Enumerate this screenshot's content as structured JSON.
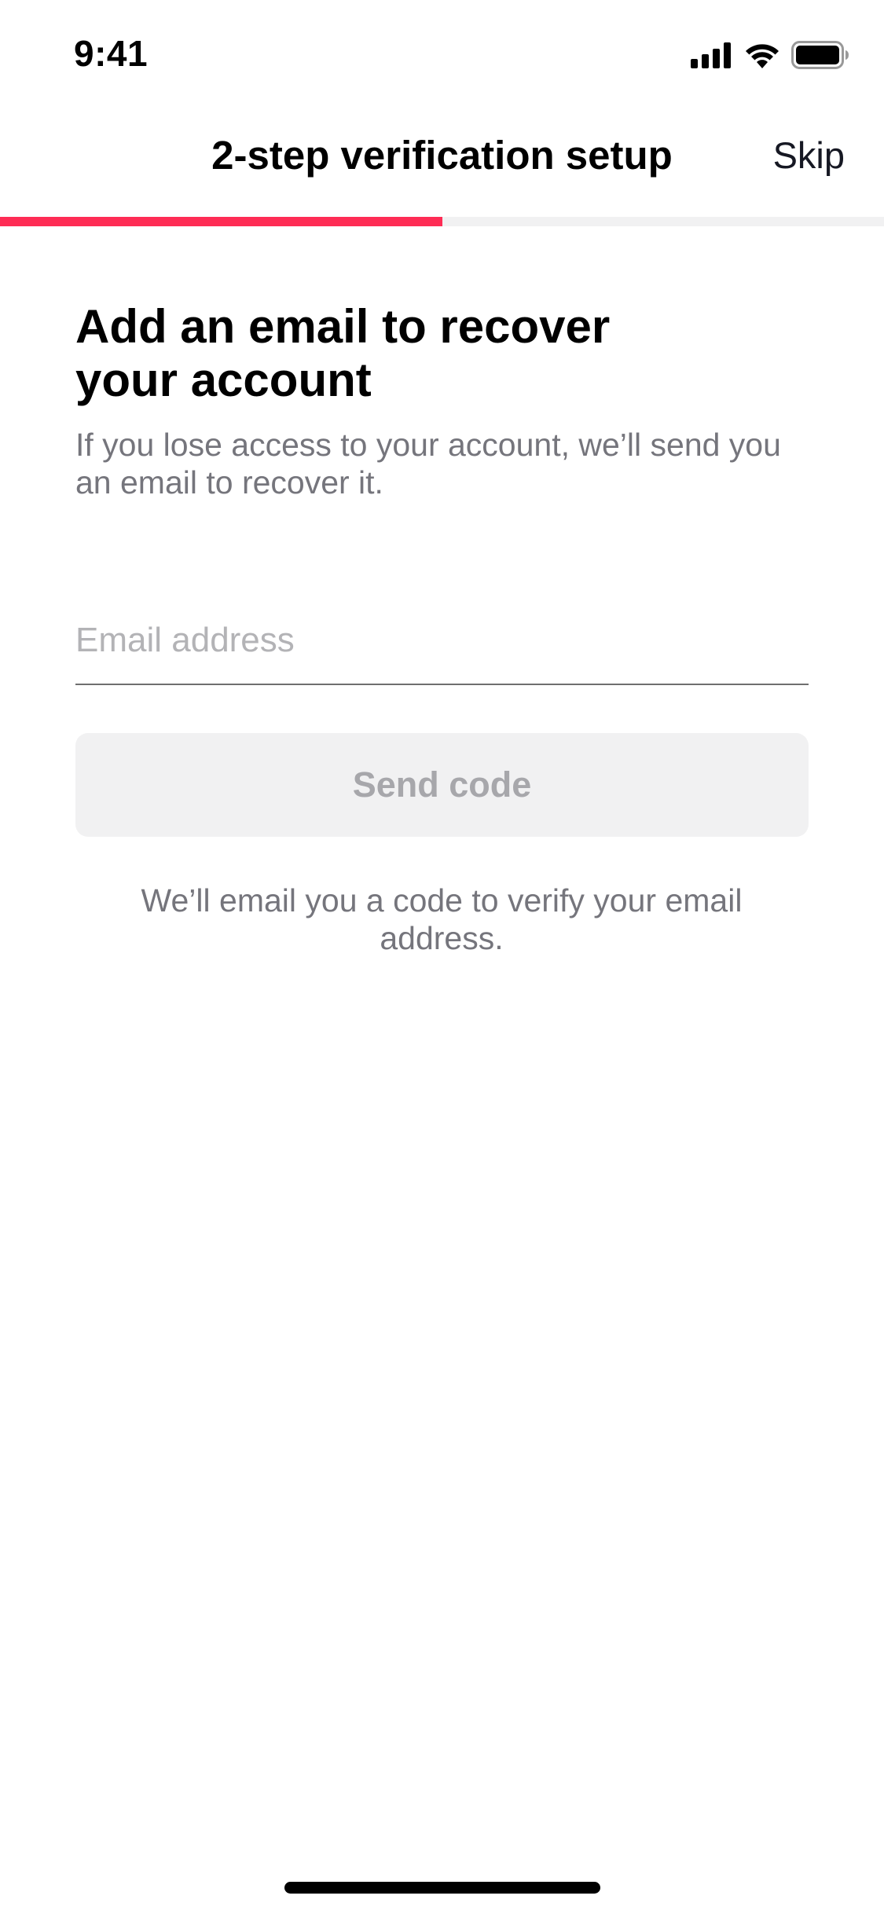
{
  "status_bar": {
    "time": "9:41",
    "icons": [
      "cellular-signal-icon",
      "wifi-icon",
      "battery-icon"
    ]
  },
  "header": {
    "title": "2-step verification setup",
    "skip_label": "Skip"
  },
  "progress": {
    "fraction": 0.5,
    "accent_color": "#fe2c55",
    "track_color": "#f1f1f2"
  },
  "content": {
    "headline": "Add an email to recover your account",
    "description": "If you lose access to your account, we’ll send you an email to recover it.",
    "email_input": {
      "value": "",
      "placeholder": "Email address"
    },
    "send_code_label": "Send code",
    "helper_text": "We’ll email you a code to verify your email address."
  }
}
